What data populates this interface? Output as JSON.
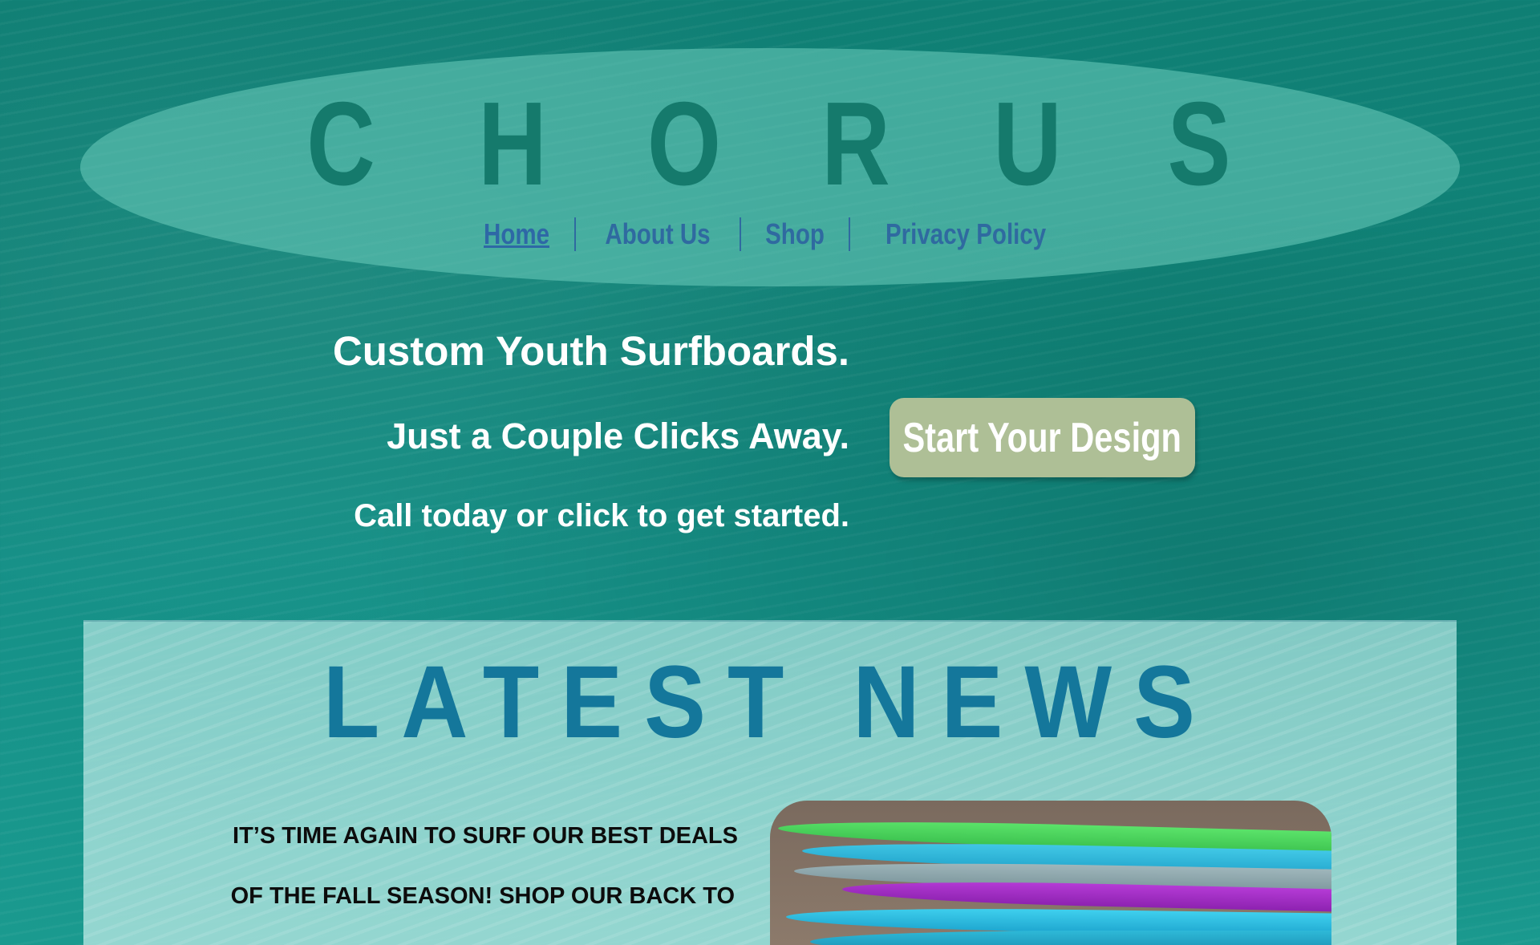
{
  "header": {
    "logo_letters": [
      "C",
      "H",
      "O",
      "R",
      "U",
      "S"
    ],
    "nav": [
      {
        "label": "Home",
        "active": true
      },
      {
        "label": "About Us",
        "active": false
      },
      {
        "label": "Shop",
        "active": false
      },
      {
        "label": "Privacy Policy",
        "active": false
      }
    ]
  },
  "hero": {
    "line1": "Custom Youth Surfboards.",
    "line2": "Just a Couple Clicks Away.",
    "line3": "Call today or click to get started.",
    "cta_label": "Start Your Design"
  },
  "news": {
    "title": "LATEST NEWS",
    "text_line1": "IT’S TIME AGAIN TO SURF OUR BEST DEALS",
    "text_line2": "OF THE FALL SEASON! SHOP OUR BACK TO"
  },
  "colors": {
    "ocean": "#118479",
    "oval": "#6ecdbe",
    "logo": "#157a6c",
    "nav_link": "#2f6aa0",
    "cta_bg": "#aebf96",
    "news_title": "#14779b"
  }
}
